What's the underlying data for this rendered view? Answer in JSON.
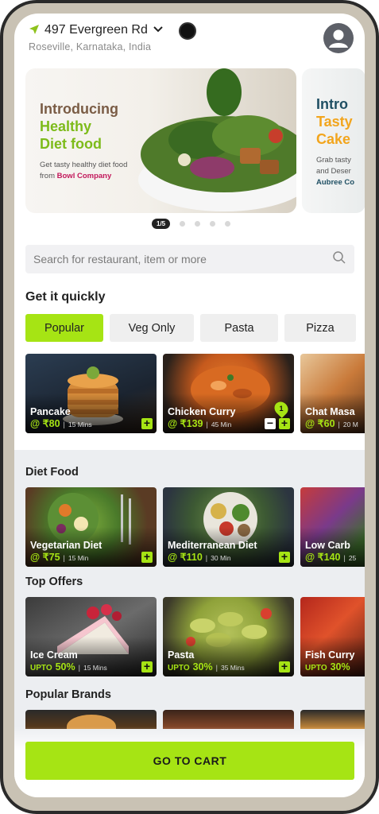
{
  "header": {
    "address": "497 Evergreen Rd",
    "subtitle": "Roseville, Karnataka, India"
  },
  "banners": [
    {
      "line1": "Introducing",
      "line2": "Healthy",
      "line3": "Diet food",
      "desc1": "Get tasty healthy diet food",
      "desc2_prefix": "from ",
      "brand": "Bowl Company"
    },
    {
      "line1": "Intro",
      "line2": "Tasty",
      "line3": "Cake",
      "desc1": "Grab tasty",
      "desc2_prefix": "and Deser",
      "brand": "Aubree Co"
    }
  ],
  "carousel": {
    "indicator": "1/5",
    "total": 5
  },
  "search": {
    "placeholder": "Search for restaurant, item or more"
  },
  "quick": {
    "title": "Get it quickly",
    "chips": [
      "Popular",
      "Veg Only",
      "Pasta",
      "Pizza"
    ],
    "active_chip": "Popular",
    "items": [
      {
        "name": "Pancake",
        "price": "@ ₹80",
        "time": "15 Mins"
      },
      {
        "name": "Chicken Curry",
        "price": "@ ₹139",
        "time": "45 Min",
        "qty": "1"
      },
      {
        "name": "Chat Masa",
        "price": "@ ₹60",
        "time": "20 M"
      }
    ]
  },
  "diet": {
    "title": "Diet Food",
    "items": [
      {
        "name": "Vegetarian Diet",
        "price": "@ ₹75",
        "time": "15 Min"
      },
      {
        "name": "Mediterranean Diet",
        "price": "@ ₹110",
        "time": "30 Min"
      },
      {
        "name": "Low Carb",
        "price": "@ ₹140",
        "time": "25"
      }
    ]
  },
  "offers": {
    "title": "Top Offers",
    "items": [
      {
        "name": "Ice Cream",
        "prefix": "UPTO",
        "discount": "50%",
        "time": "15 Mins"
      },
      {
        "name": "Pasta",
        "prefix": "UPTO",
        "discount": "30%",
        "time": "35 Mins"
      },
      {
        "name": "Fish Curry",
        "prefix": "UPTO",
        "discount": "30%",
        "time": ""
      }
    ]
  },
  "brands": {
    "title": "Popular Brands"
  },
  "cart": {
    "label": "GO TO CART"
  },
  "colors": {
    "accent": "#a6e414",
    "brand_pink": "#c2185b",
    "diet_green": "#7dbb1a",
    "banner_brown": "#7a5c45",
    "banner_teal": "#1f4f63",
    "banner_orange": "#f2a51d"
  }
}
